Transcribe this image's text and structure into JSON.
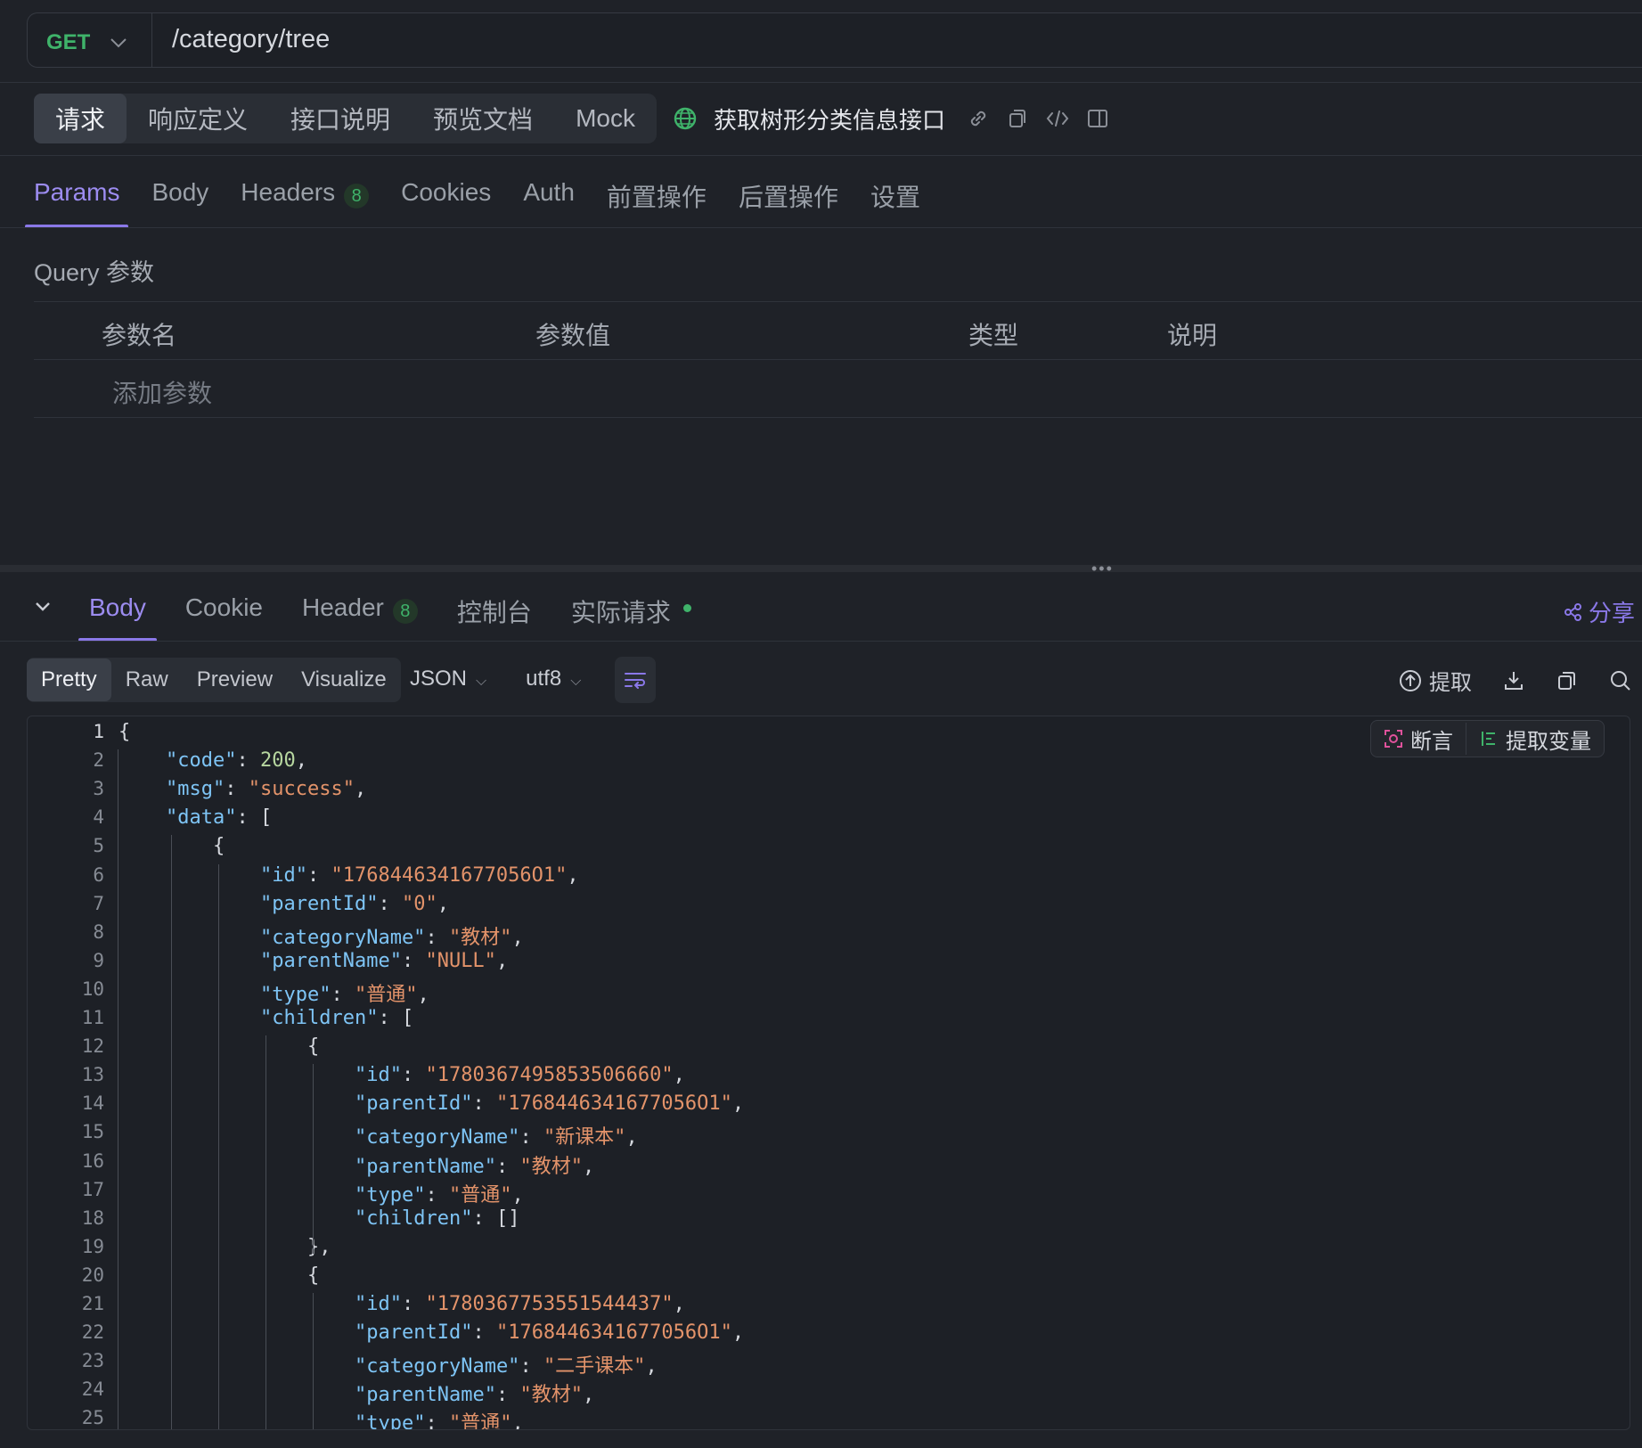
{
  "request": {
    "method": "GET",
    "url": "/category/tree"
  },
  "top_tabs": [
    "请求",
    "响应定义",
    "接口说明",
    "预览文档",
    "Mock"
  ],
  "api_name": "获取树形分类信息接口",
  "param_tabs": {
    "params": "Params",
    "body": "Body",
    "headers": "Headers",
    "headers_count": "8",
    "cookies": "Cookies",
    "auth": "Auth",
    "pre": "前置操作",
    "post": "后置操作",
    "settings": "设置"
  },
  "query": {
    "label": "Query 参数",
    "columns": [
      "参数名",
      "参数值",
      "类型",
      "说明"
    ],
    "add_placeholder": "添加参数"
  },
  "response_tabs": {
    "body": "Body",
    "cookie": "Cookie",
    "header": "Header",
    "header_count": "8",
    "console": "控制台",
    "actual": "实际请求",
    "share": "分享"
  },
  "view_modes": [
    "Pretty",
    "Raw",
    "Preview",
    "Visualize"
  ],
  "format": "JSON",
  "encoding": "utf8",
  "tools": {
    "extract": "提取"
  },
  "assert_bar": {
    "assert": "断言",
    "extract_var": "提取变量"
  },
  "code_lines": [
    {
      "n": "1",
      "indent": 0,
      "parts": [
        [
          "p",
          "{"
        ]
      ]
    },
    {
      "n": "2",
      "indent": 1,
      "parts": [
        [
          "k",
          "\"code\""
        ],
        [
          "p",
          ": "
        ],
        [
          "n",
          "200"
        ],
        [
          "p",
          ","
        ]
      ]
    },
    {
      "n": "3",
      "indent": 1,
      "parts": [
        [
          "k",
          "\"msg\""
        ],
        [
          "p",
          ": "
        ],
        [
          "s",
          "\"success\""
        ],
        [
          "p",
          ","
        ]
      ]
    },
    {
      "n": "4",
      "indent": 1,
      "parts": [
        [
          "k",
          "\"data\""
        ],
        [
          "p",
          ": ["
        ]
      ]
    },
    {
      "n": "5",
      "indent": 2,
      "parts": [
        [
          "p",
          "{"
        ]
      ]
    },
    {
      "n": "6",
      "indent": 3,
      "parts": [
        [
          "k",
          "\"id\""
        ],
        [
          "p",
          ": "
        ],
        [
          "s",
          "\"1768446341677056O1\""
        ],
        [
          "p",
          ","
        ]
      ]
    },
    {
      "n": "7",
      "indent": 3,
      "parts": [
        [
          "k",
          "\"parentId\""
        ],
        [
          "p",
          ": "
        ],
        [
          "s",
          "\"0\""
        ],
        [
          "p",
          ","
        ]
      ]
    },
    {
      "n": "8",
      "indent": 3,
      "parts": [
        [
          "k",
          "\"categoryName\""
        ],
        [
          "p",
          ": "
        ],
        [
          "s",
          "\"教材\""
        ],
        [
          "p",
          ","
        ]
      ]
    },
    {
      "n": "9",
      "indent": 3,
      "parts": [
        [
          "k",
          "\"parentName\""
        ],
        [
          "p",
          ": "
        ],
        [
          "s",
          "\"NULL\""
        ],
        [
          "p",
          ","
        ]
      ]
    },
    {
      "n": "10",
      "indent": 3,
      "parts": [
        [
          "k",
          "\"type\""
        ],
        [
          "p",
          ": "
        ],
        [
          "s",
          "\"普通\""
        ],
        [
          "p",
          ","
        ]
      ]
    },
    {
      "n": "11",
      "indent": 3,
      "parts": [
        [
          "k",
          "\"children\""
        ],
        [
          "p",
          ": ["
        ]
      ]
    },
    {
      "n": "12",
      "indent": 4,
      "parts": [
        [
          "p",
          "{"
        ]
      ]
    },
    {
      "n": "13",
      "indent": 5,
      "parts": [
        [
          "k",
          "\"id\""
        ],
        [
          "p",
          ": "
        ],
        [
          "s",
          "\"1780367495853506660\""
        ],
        [
          "p",
          ","
        ]
      ]
    },
    {
      "n": "14",
      "indent": 5,
      "parts": [
        [
          "k",
          "\"parentId\""
        ],
        [
          "p",
          ": "
        ],
        [
          "s",
          "\"1768446341677056O1\""
        ],
        [
          "p",
          ","
        ]
      ]
    },
    {
      "n": "15",
      "indent": 5,
      "parts": [
        [
          "k",
          "\"categoryName\""
        ],
        [
          "p",
          ": "
        ],
        [
          "s",
          "\"新课本\""
        ],
        [
          "p",
          ","
        ]
      ]
    },
    {
      "n": "16",
      "indent": 5,
      "parts": [
        [
          "k",
          "\"parentName\""
        ],
        [
          "p",
          ": "
        ],
        [
          "s",
          "\"教材\""
        ],
        [
          "p",
          ","
        ]
      ]
    },
    {
      "n": "17",
      "indent": 5,
      "parts": [
        [
          "k",
          "\"type\""
        ],
        [
          "p",
          ": "
        ],
        [
          "s",
          "\"普通\""
        ],
        [
          "p",
          ","
        ]
      ]
    },
    {
      "n": "18",
      "indent": 5,
      "parts": [
        [
          "k",
          "\"children\""
        ],
        [
          "p",
          ": []"
        ]
      ]
    },
    {
      "n": "19",
      "indent": 4,
      "parts": [
        [
          "p",
          "},"
        ]
      ]
    },
    {
      "n": "20",
      "indent": 4,
      "parts": [
        [
          "p",
          "{"
        ]
      ]
    },
    {
      "n": "21",
      "indent": 5,
      "parts": [
        [
          "k",
          "\"id\""
        ],
        [
          "p",
          ": "
        ],
        [
          "s",
          "\"1780367753551544437\""
        ],
        [
          "p",
          ","
        ]
      ]
    },
    {
      "n": "22",
      "indent": 5,
      "parts": [
        [
          "k",
          "\"parentId\""
        ],
        [
          "p",
          ": "
        ],
        [
          "s",
          "\"1768446341677056O1\""
        ],
        [
          "p",
          ","
        ]
      ]
    },
    {
      "n": "23",
      "indent": 5,
      "parts": [
        [
          "k",
          "\"categoryName\""
        ],
        [
          "p",
          ": "
        ],
        [
          "s",
          "\"二手课本\""
        ],
        [
          "p",
          ","
        ]
      ]
    },
    {
      "n": "24",
      "indent": 5,
      "parts": [
        [
          "k",
          "\"parentName\""
        ],
        [
          "p",
          ": "
        ],
        [
          "s",
          "\"教材\""
        ],
        [
          "p",
          ","
        ]
      ]
    },
    {
      "n": "25",
      "indent": 5,
      "parts": [
        [
          "k",
          "\"type\""
        ],
        [
          "p",
          ": "
        ],
        [
          "s",
          "\"普通\""
        ],
        [
          "p",
          ","
        ]
      ]
    }
  ]
}
